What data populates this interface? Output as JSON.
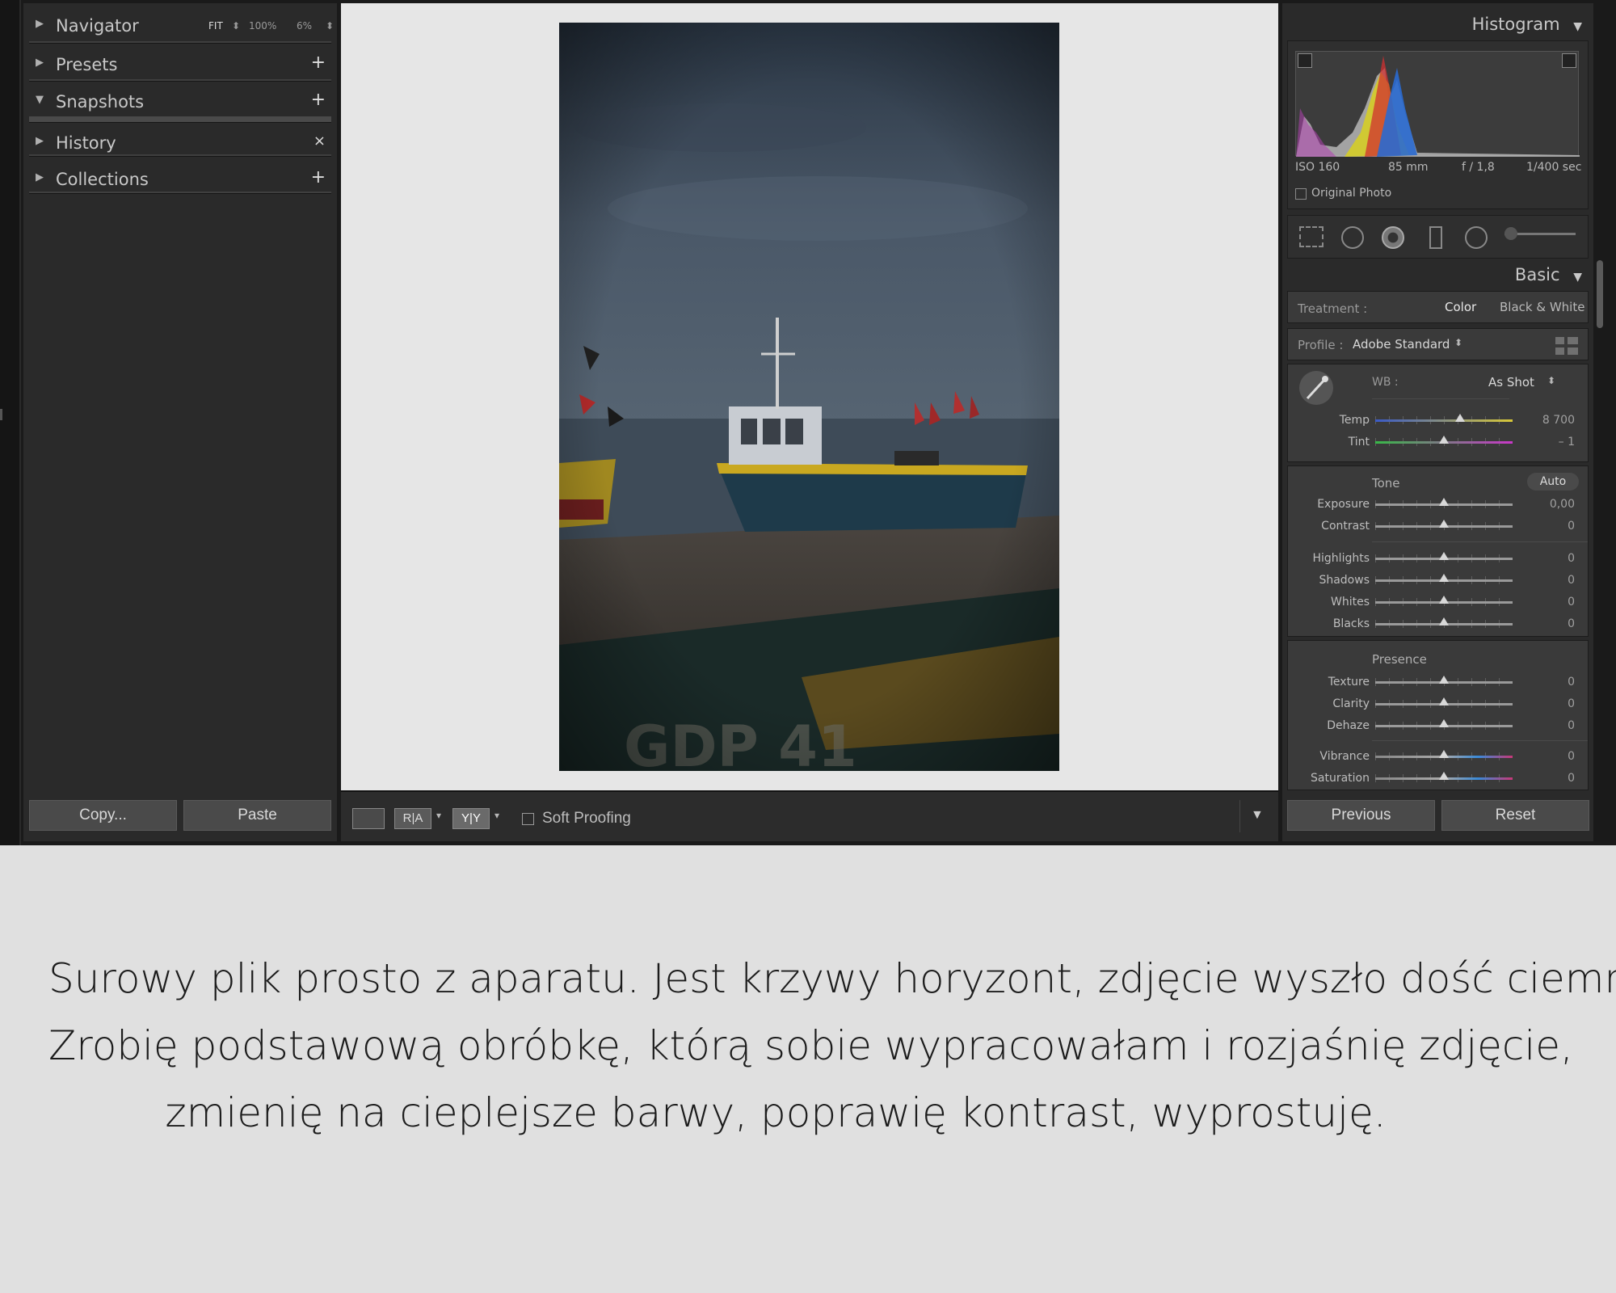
{
  "left_panel": {
    "navigator": {
      "label": "Navigator",
      "fit": "FIT",
      "zoom1": "100%",
      "zoom2": "6%"
    },
    "presets": {
      "label": "Presets",
      "action": "+"
    },
    "snapshots": {
      "label": "Snapshots",
      "action": "+"
    },
    "history": {
      "label": "History",
      "action": "×"
    },
    "collections": {
      "label": "Collections",
      "action": "+"
    },
    "copy_label": "Copy...",
    "paste_label": "Paste"
  },
  "toolbar": {
    "compare_ra": "R|A",
    "compare_yy": "Y|Y",
    "soft_proofing": "Soft Proofing"
  },
  "histogram": {
    "title": "Histogram",
    "iso": "ISO 160",
    "focal": "85 mm",
    "aperture": "f / 1,8",
    "shutter": "1/400 sec",
    "original_photo": "Original Photo"
  },
  "basic": {
    "title": "Basic",
    "treatment_label": "Treatment :",
    "treatment_color": "Color",
    "treatment_bw": "Black & White",
    "profile_label": "Profile :",
    "profile_value": "Adobe Standard",
    "wb_label": "WB :",
    "wb_value": "As Shot",
    "tone_label": "Tone",
    "auto_label": "Auto",
    "presence_label": "Presence",
    "sliders": {
      "temp": {
        "label": "Temp",
        "value": "8 700",
        "level": 0.62
      },
      "tint": {
        "label": "Tint",
        "value": "– 1",
        "level": 0.5
      },
      "exposure": {
        "label": "Exposure",
        "value": "0,00",
        "level": 0.5
      },
      "contrast": {
        "label": "Contrast",
        "value": "0",
        "level": 0.5
      },
      "highlights": {
        "label": "Highlights",
        "value": "0",
        "level": 0.5
      },
      "shadows": {
        "label": "Shadows",
        "value": "0",
        "level": 0.5
      },
      "whites": {
        "label": "Whites",
        "value": "0",
        "level": 0.5
      },
      "blacks": {
        "label": "Blacks",
        "value": "0",
        "level": 0.5
      },
      "texture": {
        "label": "Texture",
        "value": "0",
        "level": 0.5
      },
      "clarity": {
        "label": "Clarity",
        "value": "0",
        "level": 0.5
      },
      "dehaze": {
        "label": "Dehaze",
        "value": "0",
        "level": 0.5
      },
      "vibrance": {
        "label": "Vibrance",
        "value": "0",
        "level": 0.5
      },
      "saturation": {
        "label": "Saturation",
        "value": "0",
        "level": 0.5
      }
    },
    "previous_label": "Previous",
    "reset_label": "Reset"
  },
  "icons": [
    "arrow-right-icon",
    "arrow-down-icon",
    "plus-icon",
    "close-icon",
    "eyedropper-icon",
    "grid-icon",
    "crop-icon",
    "spot-removal-icon",
    "redeye-icon",
    "graduated-filter-icon",
    "radial-filter-icon",
    "brush-icon",
    "loupe-view-icon",
    "dropdown-icon"
  ],
  "caption": {
    "line1": "Surowy plik prosto z aparatu. Jest krzywy horyzont, zdjęcie wyszło dość ciemne.",
    "line2": "Zrobię podstawową obróbkę, którą sobie wypracowałam i rozjaśnię zdjęcie,",
    "line3": "zmienię na cieplejsze barwy, poprawię kontrast, wyprostuję."
  }
}
